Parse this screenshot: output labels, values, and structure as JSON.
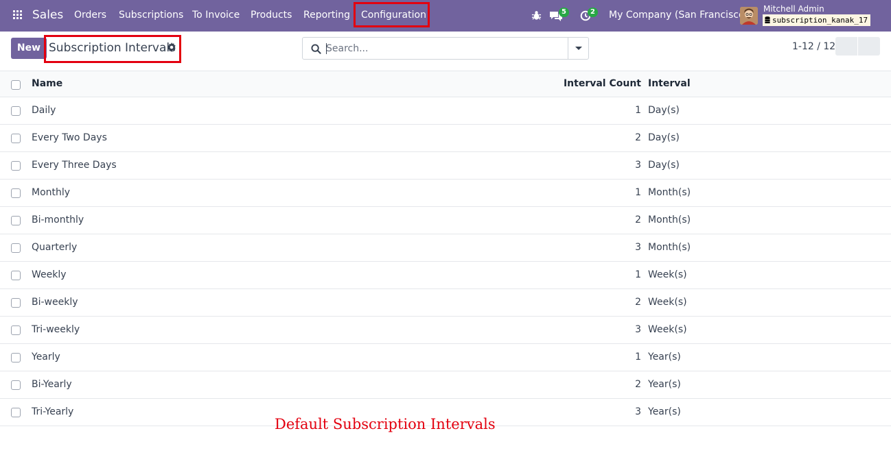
{
  "navbar": {
    "app_name": "Sales",
    "menu": [
      "Orders",
      "Subscriptions",
      "To Invoice",
      "Products",
      "Reporting",
      "Configuration"
    ],
    "messages_count": "5",
    "activities_count": "2",
    "company": "My Company (San Francisco)",
    "user_name": "Mitchell Admin",
    "database": "subscription_kanak_17"
  },
  "control": {
    "new_label": "New",
    "title": "Subscription Intervals",
    "search_placeholder": "Search...",
    "pager": "1-12 / 12"
  },
  "table": {
    "headers": {
      "name": "Name",
      "count": "Interval Count",
      "interval": "Interval"
    },
    "rows": [
      {
        "name": "Daily",
        "count": "1",
        "interval": "Day(s)"
      },
      {
        "name": "Every Two Days",
        "count": "2",
        "interval": "Day(s)"
      },
      {
        "name": "Every Three Days",
        "count": "3",
        "interval": "Day(s)"
      },
      {
        "name": "Monthly",
        "count": "1",
        "interval": "Month(s)"
      },
      {
        "name": "Bi-monthly",
        "count": "2",
        "interval": "Month(s)"
      },
      {
        "name": "Quarterly",
        "count": "3",
        "interval": "Month(s)"
      },
      {
        "name": "Weekly",
        "count": "1",
        "interval": "Week(s)"
      },
      {
        "name": "Bi-weekly",
        "count": "2",
        "interval": "Week(s)"
      },
      {
        "name": "Tri-weekly",
        "count": "3",
        "interval": "Week(s)"
      },
      {
        "name": "Yearly",
        "count": "1",
        "interval": "Year(s)"
      },
      {
        "name": "Bi-Yearly",
        "count": "2",
        "interval": "Year(s)"
      },
      {
        "name": "Tri-Yearly",
        "count": "3",
        "interval": "Year(s)"
      }
    ]
  },
  "caption": "Default Subscription Intervals",
  "colors": {
    "brand": "#71639e",
    "highlight": "#e3000f",
    "badge": "#28a745"
  }
}
